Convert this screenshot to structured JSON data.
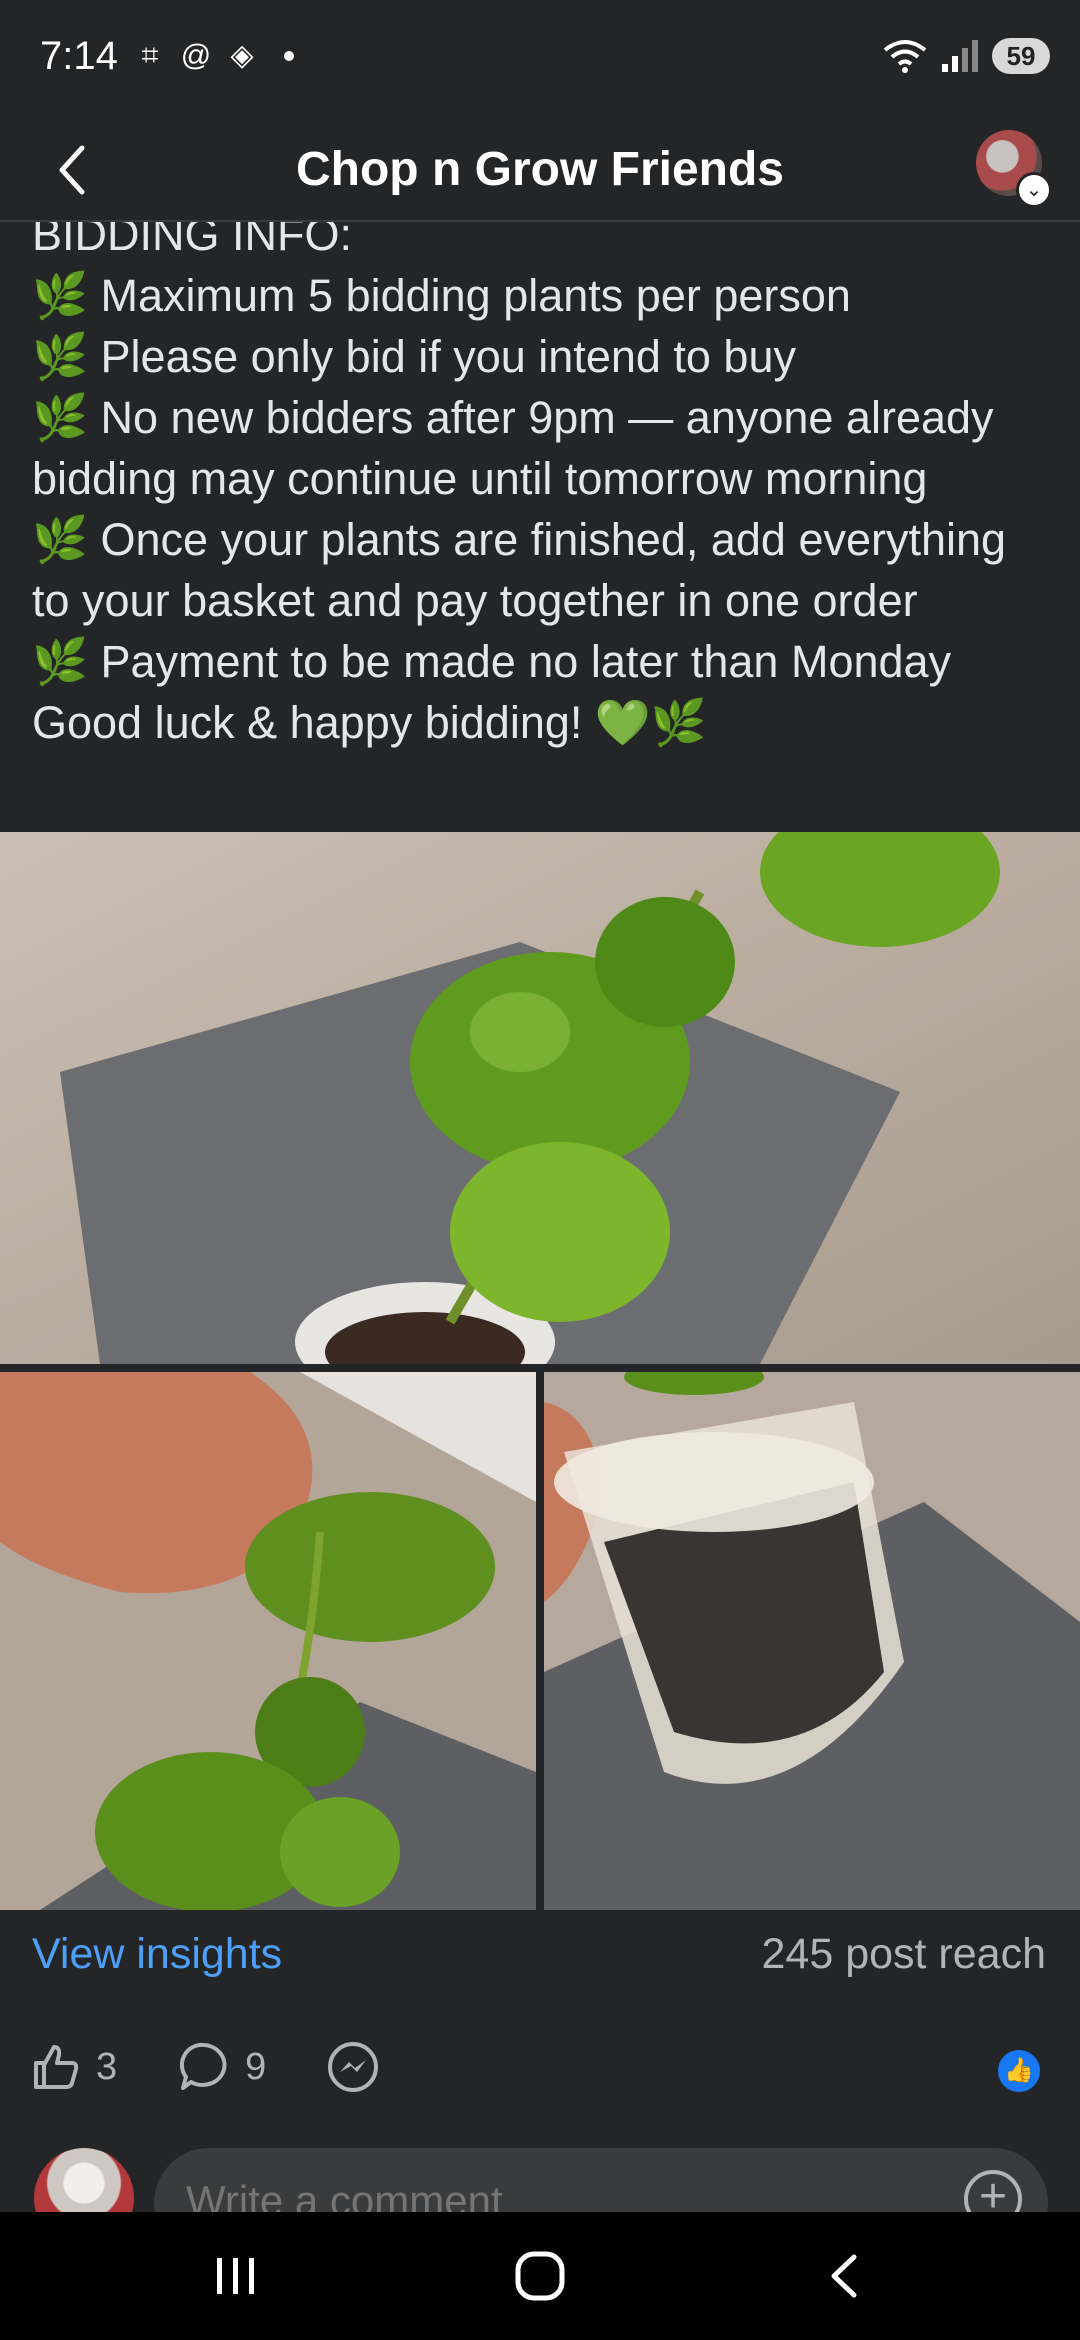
{
  "status_bar": {
    "time": "7:14",
    "battery": "59",
    "icons": [
      "screenshot-icon",
      "threads-icon",
      "layers-icon",
      "wifi-icon",
      "signal-icon"
    ]
  },
  "header": {
    "title": "Chop n Grow Friends",
    "back_icon": "chevron-left-icon"
  },
  "post": {
    "lines": [
      "BIDDING INFO:",
      "🌿 Maximum 5 bidding plants per person",
      "🌿 Please only bid if you intend to buy",
      "🌿 No new bidders after 9pm — anyone already bidding may continue until tomorrow morning",
      "🌿 Once your plants are finished, add everything to your basket and pay together in one order",
      "🌿 Payment to be made no later than Monday",
      "Good luck & happy bidding! 💚🌿"
    ]
  },
  "insights": {
    "link": "View insights",
    "reach": "245 post reach"
  },
  "actions": {
    "likes": "3",
    "comments": "9"
  },
  "comment": {
    "placeholder": "Write a comment"
  },
  "colors": {
    "background": "#242526",
    "link": "#4d9ff7",
    "like_badge": "#1877f2",
    "leaf": "#6bcf4a"
  }
}
